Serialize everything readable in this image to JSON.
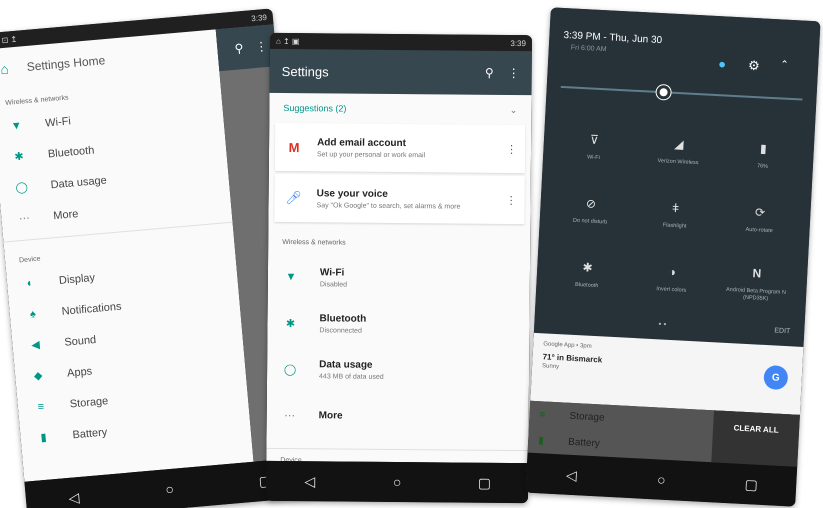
{
  "status_bar": {
    "time": "3:39"
  },
  "nav": {
    "back": "◁",
    "home": "○",
    "recents": "▢"
  },
  "drawer": {
    "title": "Settings Home",
    "section_wireless": "Wireless & networks",
    "wireless_items": [
      "Wi-Fi",
      "Bluetooth",
      "Data usage",
      "More"
    ],
    "section_device": "Device",
    "device_items": [
      "Display",
      "Notifications",
      "Sound",
      "Apps",
      "Storage",
      "Battery"
    ]
  },
  "settings": {
    "title": "Settings",
    "suggestions_label": "Suggestions (2)",
    "suggestions": [
      {
        "title": "Add email account",
        "subtitle": "Set up your personal or work email"
      },
      {
        "title": "Use your voice",
        "subtitle": "Say \"Ok Google\" to search, set alarms & more"
      }
    ],
    "section_wireless": "Wireless & networks",
    "items": [
      {
        "title": "Wi-Fi",
        "subtitle": "Disabled"
      },
      {
        "title": "Bluetooth",
        "subtitle": "Disconnected"
      },
      {
        "title": "Data usage",
        "subtitle": "443 MB of data used"
      },
      {
        "title": "More",
        "subtitle": ""
      }
    ],
    "section_device": "Device"
  },
  "quick_settings": {
    "datetime": "3:39 PM - Thu, Jun 30",
    "alarm": "Fri 6:00 AM",
    "tiles": [
      {
        "label": "Wi-Fi",
        "icon": "wifi-off-icon"
      },
      {
        "label": "Verizon Wireless",
        "icon": "signal-icon"
      },
      {
        "label": "76%",
        "icon": "battery-icon"
      },
      {
        "label": "Do not disturb",
        "icon": "dnd-icon"
      },
      {
        "label": "Flashlight",
        "icon": "flashlight-icon"
      },
      {
        "label": "Auto-rotate",
        "icon": "rotate-icon"
      },
      {
        "label": "Bluetooth",
        "icon": "bluetooth-icon"
      },
      {
        "label": "Invert colors",
        "icon": "invert-icon"
      },
      {
        "label": "Android Beta Program N (NPD35K)",
        "icon": "android-n-icon"
      }
    ],
    "edit_label": "EDIT",
    "notification": {
      "app": "Google App • 3pm",
      "title": "71° in Bismarck",
      "subtitle": "Sunny"
    },
    "underlay_items": [
      "Storage",
      "Battery"
    ],
    "clear_all": "CLEAR ALL"
  },
  "colors": {
    "accent": "#009688",
    "appbar": "#37474f",
    "shade": "#263238"
  }
}
